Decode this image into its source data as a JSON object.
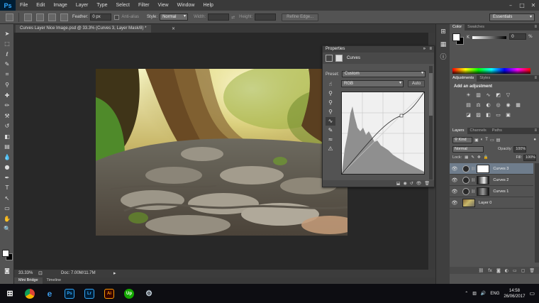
{
  "app": {
    "logo": "Ps"
  },
  "menu": [
    "File",
    "Edit",
    "Image",
    "Layer",
    "Type",
    "Select",
    "Filter",
    "View",
    "Window",
    "Help"
  ],
  "options_bar": {
    "feather_label": "Feather:",
    "feather_value": "0 px",
    "antialias_label": "Anti-alias",
    "style_label": "Style:",
    "style_value": "Normal",
    "width_label": "Width:",
    "height_label": "Height:",
    "refine_edge_label": "Refine Edge...",
    "workspace": "Essentials"
  },
  "document": {
    "tab_title": "Curves Layer Nice Image.psd @ 33.3% (Curves 3, Layer Mask/8) *",
    "zoom": "33.33%",
    "doc_info": "Doc: 7.00M/11.7M"
  },
  "bottom_tabs": [
    "Mini Bridge",
    "Timeline"
  ],
  "properties": {
    "panel_title": "Properties",
    "heading": "Curves",
    "preset_label": "Preset:",
    "preset_value": "Custom",
    "channel_value": "RGB",
    "auto_label": "Auto"
  },
  "color_panel": {
    "tabs": [
      "Color",
      "Swatches"
    ],
    "k_label": "K",
    "value": "0",
    "unit": "%"
  },
  "adjustments_panel": {
    "tabs": [
      "Adjustments",
      "Styles"
    ],
    "heading": "Add an adjustment"
  },
  "layers_panel": {
    "tabs": [
      "Layers",
      "Channels",
      "Paths"
    ],
    "kind_label": "Kind",
    "blend_mode": "Normal",
    "opacity_label": "Opacity:",
    "opacity_value": "100%",
    "lock_label": "Lock:",
    "fill_label": "Fill:",
    "fill_value": "100%",
    "layers": [
      {
        "name": "Curves 3"
      },
      {
        "name": "Curves 2"
      },
      {
        "name": "Curves 1"
      },
      {
        "name": "Layer 0"
      }
    ]
  },
  "taskbar": {
    "apps": [
      "Chrome",
      "Edge",
      "Ps",
      "Lr",
      "Ai",
      "Up",
      "Steam"
    ],
    "lang": "ENG",
    "time": "14:58",
    "date": "26/06/2017"
  }
}
